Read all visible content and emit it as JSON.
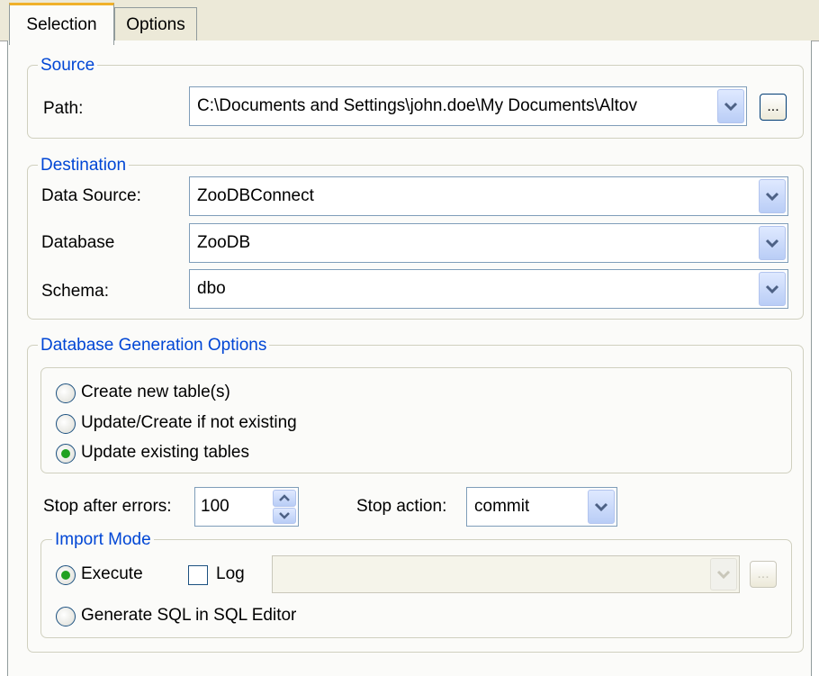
{
  "tabs": [
    {
      "label": "Selection",
      "active": true
    },
    {
      "label": "Options",
      "active": false
    }
  ],
  "source": {
    "legend": "Source",
    "path_label": "Path:",
    "path_value": "C:\\Documents and Settings\\john.doe\\My Documents\\Altov",
    "browse_label": "..."
  },
  "destination": {
    "legend": "Destination",
    "datasource_label": "Data Source:",
    "datasource_value": "ZooDBConnect",
    "database_label": "Database",
    "database_value": "ZooDB",
    "schema_label": "Schema:",
    "schema_value": "dbo"
  },
  "generation": {
    "legend": "Database Generation Options",
    "options": [
      {
        "label": "Create new table(s)",
        "checked": false
      },
      {
        "label": "Update/Create if not existing",
        "checked": false
      },
      {
        "label": "Update existing tables",
        "checked": true
      }
    ],
    "stop_errors_label": "Stop after errors:",
    "stop_errors_value": "100",
    "stop_action_label": "Stop action:",
    "stop_action_value": "commit"
  },
  "import_mode": {
    "legend": "Import Mode",
    "execute_label": "Execute",
    "execute_checked": true,
    "log_label": "Log",
    "log_checked": false,
    "log_path_value": "",
    "log_browse_label": "...",
    "generate_sql_label": "Generate SQL in SQL Editor",
    "generate_sql_checked": false
  },
  "colors": {
    "legend_blue": "#0046d5",
    "tab_accent": "#f0b12a",
    "radio_dot": "#21a121"
  }
}
